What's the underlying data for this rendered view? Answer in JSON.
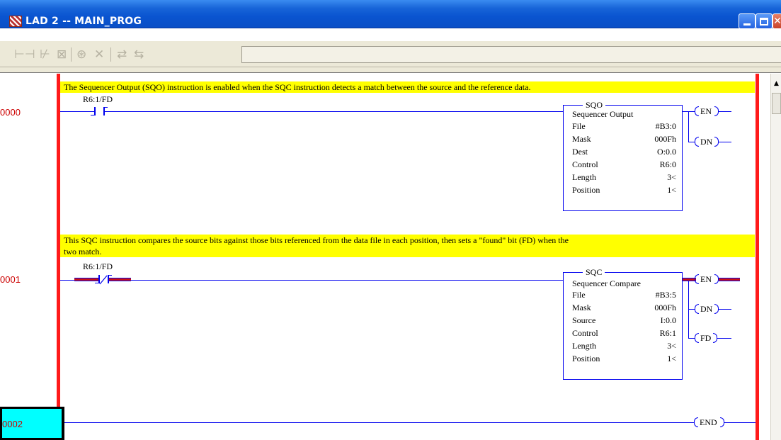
{
  "window": {
    "title": "LAD 2 -- MAIN_PROG",
    "icons": {
      "app": "ladder-app-icon",
      "minimize": "minimize-icon",
      "maximize": "maximize-icon",
      "close": "close-icon"
    }
  },
  "toolbar": {
    "tools": [
      {
        "name": "insert-branch-icon",
        "glyph": "⊢⊣"
      },
      {
        "name": "edit-rung-icon",
        "glyph": "⊬"
      },
      {
        "name": "cancel-edits-icon",
        "glyph": "⊠"
      },
      {
        "name": "accept-rung-icon",
        "glyph": "⊛"
      },
      {
        "name": "delete-icon",
        "glyph": "✕"
      },
      {
        "name": "test-edits-icon",
        "glyph": "⇄"
      },
      {
        "name": "untest-edits-icon",
        "glyph": "⇆"
      }
    ],
    "address_value": ""
  },
  "rungs": [
    {
      "number": "0000",
      "comment": "The Sequencer Output (SQO) instruction is enabled when the SQC instruction detects a match between the source and the reference data.",
      "contact": {
        "type": "XIC",
        "address": "R6:1/FD",
        "energized": false
      },
      "instruction": {
        "mnemonic": "SQO",
        "title": "Sequencer Output",
        "params": [
          {
            "label": "File",
            "value": "#B3:0"
          },
          {
            "label": "Mask",
            "value": "000Fh"
          },
          {
            "label": "Dest",
            "value": "O:0.0"
          },
          {
            "label": "Control",
            "value": "R6:0"
          },
          {
            "label": "Length",
            "value": "3<"
          },
          {
            "label": "Position",
            "value": "1<"
          }
        ],
        "outputs": [
          "EN",
          "DN"
        ]
      }
    },
    {
      "number": "0001",
      "comment_line1": "This SQC instruction compares the source bits against those bits referenced from the data file in each position, then sets a \"found\" bit (FD) when the",
      "comment_line2": "two match.",
      "contact": {
        "type": "XIO",
        "address": "R6:1/FD",
        "energized": true
      },
      "instruction": {
        "mnemonic": "SQC",
        "title": "Sequencer Compare",
        "params": [
          {
            "label": "File",
            "value": "#B3:5"
          },
          {
            "label": "Mask",
            "value": "000Fh"
          },
          {
            "label": "Source",
            "value": "I:0.0"
          },
          {
            "label": "Control",
            "value": "R6:1"
          },
          {
            "label": "Length",
            "value": "3<"
          },
          {
            "label": "Position",
            "value": "1<"
          }
        ],
        "outputs": [
          "EN",
          "DN",
          "FD"
        ]
      }
    },
    {
      "number": "0002",
      "output": "END",
      "selected": true
    }
  ],
  "colors": {
    "rail": "#ff1a1a",
    "wire": "#0000ee",
    "comment_bg": "#ffff00",
    "rung_number": "#cc0000",
    "selected_rung_bg": "#00ffff",
    "energized": "#cc1111"
  }
}
